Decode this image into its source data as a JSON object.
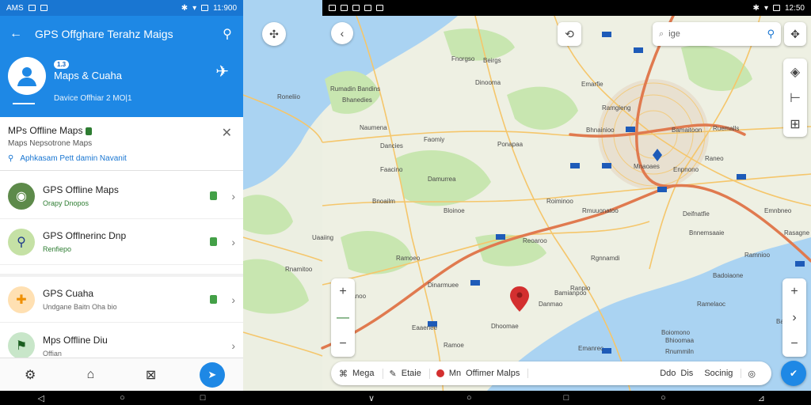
{
  "status_left": {
    "carrier": "AMS",
    "time": "11:900"
  },
  "status_right": {
    "time": "12:50"
  },
  "header": {
    "title": "GPS Offghare Terahz Maigs",
    "badge": "1.3",
    "app_name": "Maps & Cuaha",
    "meta": "Davice Offhiar 2 MO|1"
  },
  "search_card": {
    "title": "MPs Offline Maps",
    "subtitle": "Maps  Nepsotrone Maps",
    "link": "Aphkasam Pett damin Navanit"
  },
  "list": [
    {
      "title": "GPS Offline Maps",
      "sub": "Orapy Dnopos"
    },
    {
      "title": "GPS Offlnerinc Dnp",
      "sub": "Renfiepo"
    },
    {
      "title": "GPS Cuaha",
      "sub": "Undgane Baitn Oha bio"
    },
    {
      "title": "Mps Offline Diu",
      "sub": "Offian"
    }
  ],
  "map": {
    "search_placeholder": "ige",
    "bottom_bar": {
      "item1": "Mega",
      "item2": "Etaie",
      "item3": "Mn",
      "item4": "Offimer Malps",
      "item5": "Ddo",
      "item6": "Dis",
      "item7": "Socinig"
    },
    "labels": [
      "Roneliio",
      "Rumadin Bandins",
      "Bhanedies",
      "Naumena",
      "Dancies",
      "Faomiy",
      "Faacino",
      "Damurrea",
      "Beirgs",
      "Ponapaa",
      "Emarfie",
      "Rmuuonatoo",
      "Bamaitoon",
      "Enpnono",
      "Ruemalls",
      "Raneo",
      "Ramgieng",
      "Roiminoo",
      "Bloinoe",
      "Ramoeo",
      "Uaaiing",
      "Rnamitoo",
      "Deifnatfie",
      "Bnnemsaaie",
      "Rasagne",
      "Emnbneo",
      "Rgnnamdi",
      "Ranpio",
      "Danmao",
      "Dhoomae",
      "Eaaenee",
      "Ramoe",
      "Emanrec",
      "Boiomono",
      "Bhioomaa",
      "Rnummiln",
      "Baamiora",
      "Ramnioo",
      "Mnaoaes",
      "Bamianpoo",
      "Bnaanoo",
      "Dinarmuee",
      "Badoiaone",
      "Ramelaoc",
      "Reoaroo",
      "Bhnainioo",
      "Fnorgso",
      "Dinooma",
      "Bnoailm"
    ]
  },
  "colors": {
    "header_blue": "#1e88e5",
    "status_blue": "#1976d2",
    "land": "#eef0e3",
    "water": "#aad3f2",
    "forest": "#c8e6b0",
    "highway": "#e07a4f",
    "road": "#f5c66b"
  }
}
